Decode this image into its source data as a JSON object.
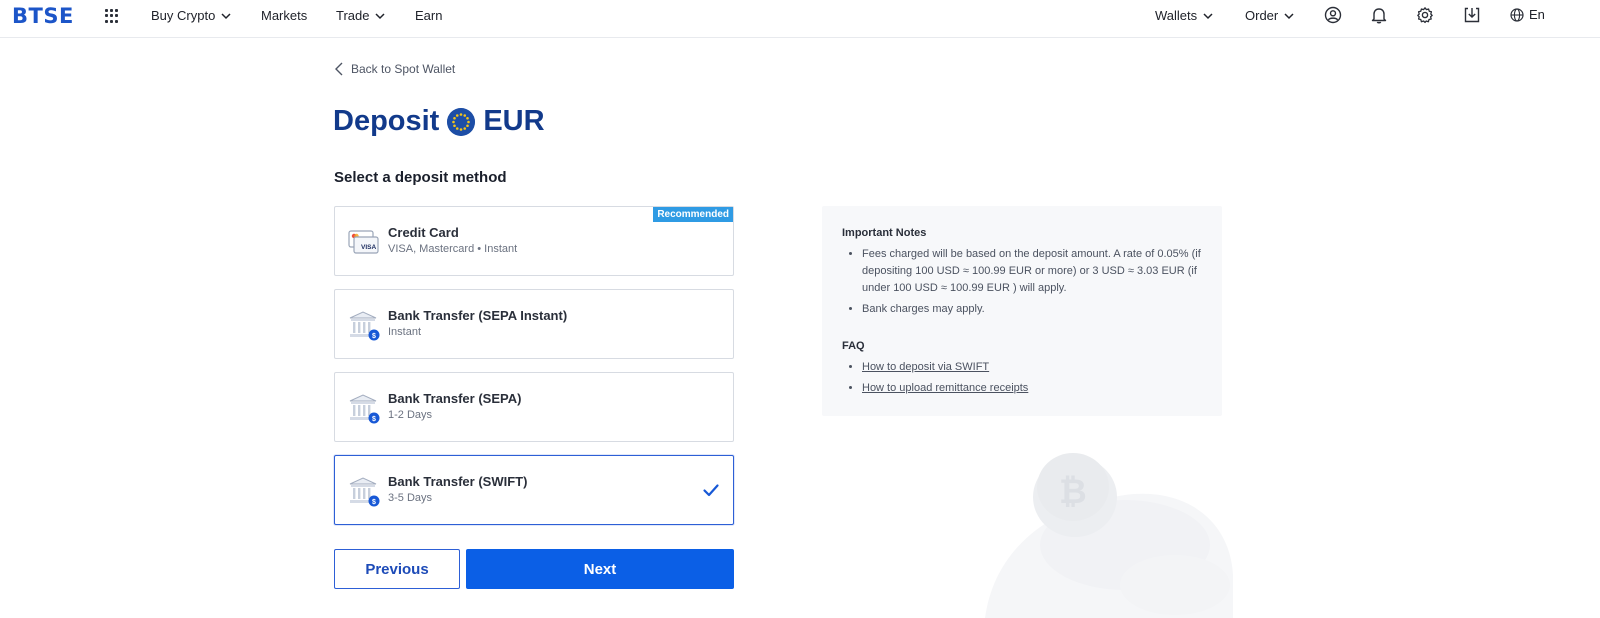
{
  "nav": {
    "logo": "BTSE",
    "buy_crypto": "Buy Crypto",
    "markets": "Markets",
    "trade": "Trade",
    "earn": "Earn",
    "wallets": "Wallets",
    "order": "Order",
    "language": "En"
  },
  "page": {
    "back_label": "Back to Spot Wallet",
    "title_prefix": "Deposit",
    "currency": "EUR",
    "section_title": "Select a deposit method"
  },
  "methods": [
    {
      "title": "Credit Card",
      "subtitle": "VISA, Mastercard • Instant",
      "badge": "Recommended",
      "icon": "credit-card-icon",
      "selected": false
    },
    {
      "title": "Bank Transfer (SEPA Instant)",
      "subtitle": "Instant",
      "icon": "bank-icon",
      "selected": false
    },
    {
      "title": "Bank Transfer (SEPA)",
      "subtitle": "1-2 Days",
      "icon": "bank-icon",
      "selected": false
    },
    {
      "title": "Bank Transfer (SWIFT)",
      "subtitle": "3-5 Days",
      "icon": "bank-icon",
      "selected": true
    }
  ],
  "buttons": {
    "previous": "Previous",
    "next": "Next"
  },
  "notes": {
    "title": "Important Notes",
    "items": [
      "Fees charged will be based on the deposit amount. A rate of 0.05% (if depositing 100 USD ≈ 100.99 EUR or more) or 3 USD ≈ 3.03 EUR (if under 100 USD ≈ 100.99 EUR ) will apply.",
      "Bank charges may apply."
    ],
    "faq_title": "FAQ",
    "faq_links": [
      "How to deposit via SWIFT",
      "How to upload remittance receipts"
    ]
  },
  "colors": {
    "brand": "#1c55c8",
    "title": "#123a8b",
    "primary_button": "#0b5fe6",
    "badge": "#2f9be4"
  }
}
